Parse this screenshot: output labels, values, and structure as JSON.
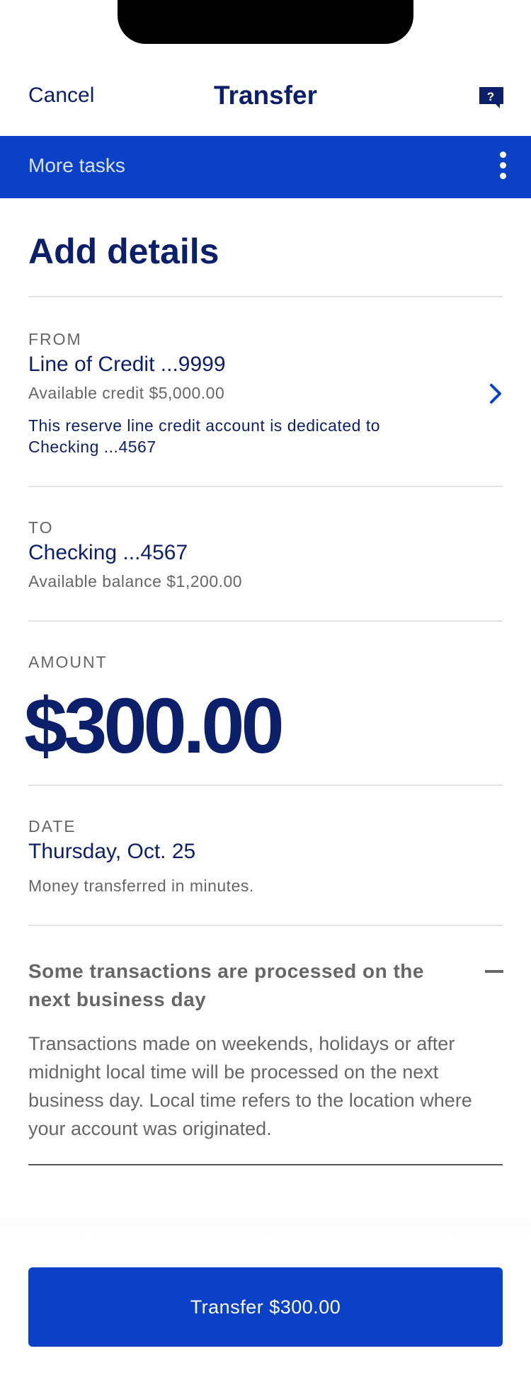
{
  "header": {
    "cancel_label": "Cancel",
    "title": "Transfer",
    "help_icon_glyph": "?"
  },
  "more_tasks": {
    "label": "More tasks",
    "icon": "kebab-menu-icon"
  },
  "page": {
    "heading": "Add details"
  },
  "from": {
    "label": "FROM",
    "account": "Line of Credit ...9999",
    "available": "Available credit $5,000.00",
    "note": "This reserve line credit account is dedicated to Checking ...4567",
    "icon": "chevron-right-icon"
  },
  "to": {
    "label": "TO",
    "account": "Checking ...4567",
    "available": "Available balance $1,200.00"
  },
  "amount": {
    "label": "AMOUNT",
    "value": "$300.00"
  },
  "date": {
    "label": "DATE",
    "value": "Thursday, Oct. 25",
    "note": "Money transferred in minutes."
  },
  "accordion": {
    "title": "Some transactions are processed on the next business day",
    "body": "Transactions made on weekends, holidays or after midnight local time will be processed on the next business day. Local time refers to the location where your account was originated.",
    "icon": "minus-collapse-icon"
  },
  "footer": {
    "button_label": "Transfer $300.00"
  },
  "colors": {
    "brand_blue": "#0b41c6",
    "navy_text": "#0b1f6b",
    "gray_text": "#666666"
  }
}
